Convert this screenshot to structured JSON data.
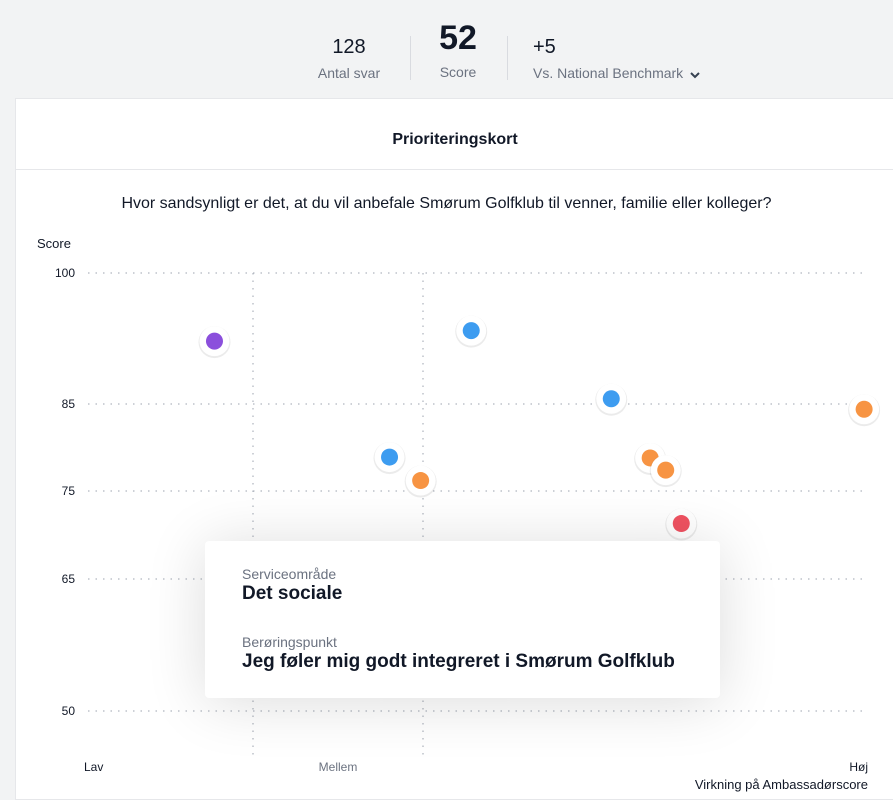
{
  "stats": {
    "responses": {
      "value": "128",
      "label": "Antal svar"
    },
    "score": {
      "value": "52",
      "label": "Score"
    },
    "benchmark": {
      "value": "+5",
      "label": "Vs. National Benchmark",
      "icon": "chevron-down-icon"
    }
  },
  "card": {
    "title": "Prioriteringskort",
    "question": "Hvor sandsynligt er det, at du vil anbefale Smørum Golfklub til venner, familie eller kolleger?"
  },
  "chart_data": {
    "type": "scatter",
    "ylabel": "Score",
    "xlabel": "Virkning på Ambassadørscore",
    "y_ticks": [
      100,
      85,
      75,
      65,
      50
    ],
    "x_labels": [
      "Lav",
      "Mellem",
      "Høj"
    ],
    "x_label_positions": [
      0,
      0.385,
      1
    ],
    "ylim": [
      50,
      100
    ],
    "xlim": [
      0,
      1
    ],
    "grid": true,
    "points": [
      {
        "x": 0.16,
        "y": 92.2,
        "color": "#8b4fdc"
      },
      {
        "x": 0.49,
        "y": 93.4,
        "color": "#3d9cf0"
      },
      {
        "x": 0.67,
        "y": 85.6,
        "color": "#3d9cf0"
      },
      {
        "x": 0.995,
        "y": 84.4,
        "color": "#f79443"
      },
      {
        "x": 0.385,
        "y": 78.9,
        "color": "#3d9cf0"
      },
      {
        "x": 0.425,
        "y": 76.2,
        "color": "#f79443"
      },
      {
        "x": 0.72,
        "y": 78.8,
        "color": "#f79443"
      },
      {
        "x": 0.74,
        "y": 77.4,
        "color": "#f79443"
      },
      {
        "x": 0.76,
        "y": 71.3,
        "color": "#f05261"
      }
    ],
    "colors": {
      "purple": "#8b4fdc",
      "blue": "#3d9cf0",
      "orange": "#f79443",
      "red": "#f05261"
    }
  },
  "tooltip": {
    "area_label": "Serviceområde",
    "area_value": "Det sociale",
    "touchpoint_label": "Berøringspunkt",
    "touchpoint_value": "Jeg føler mig godt integreret i Smørum Golfklub"
  }
}
